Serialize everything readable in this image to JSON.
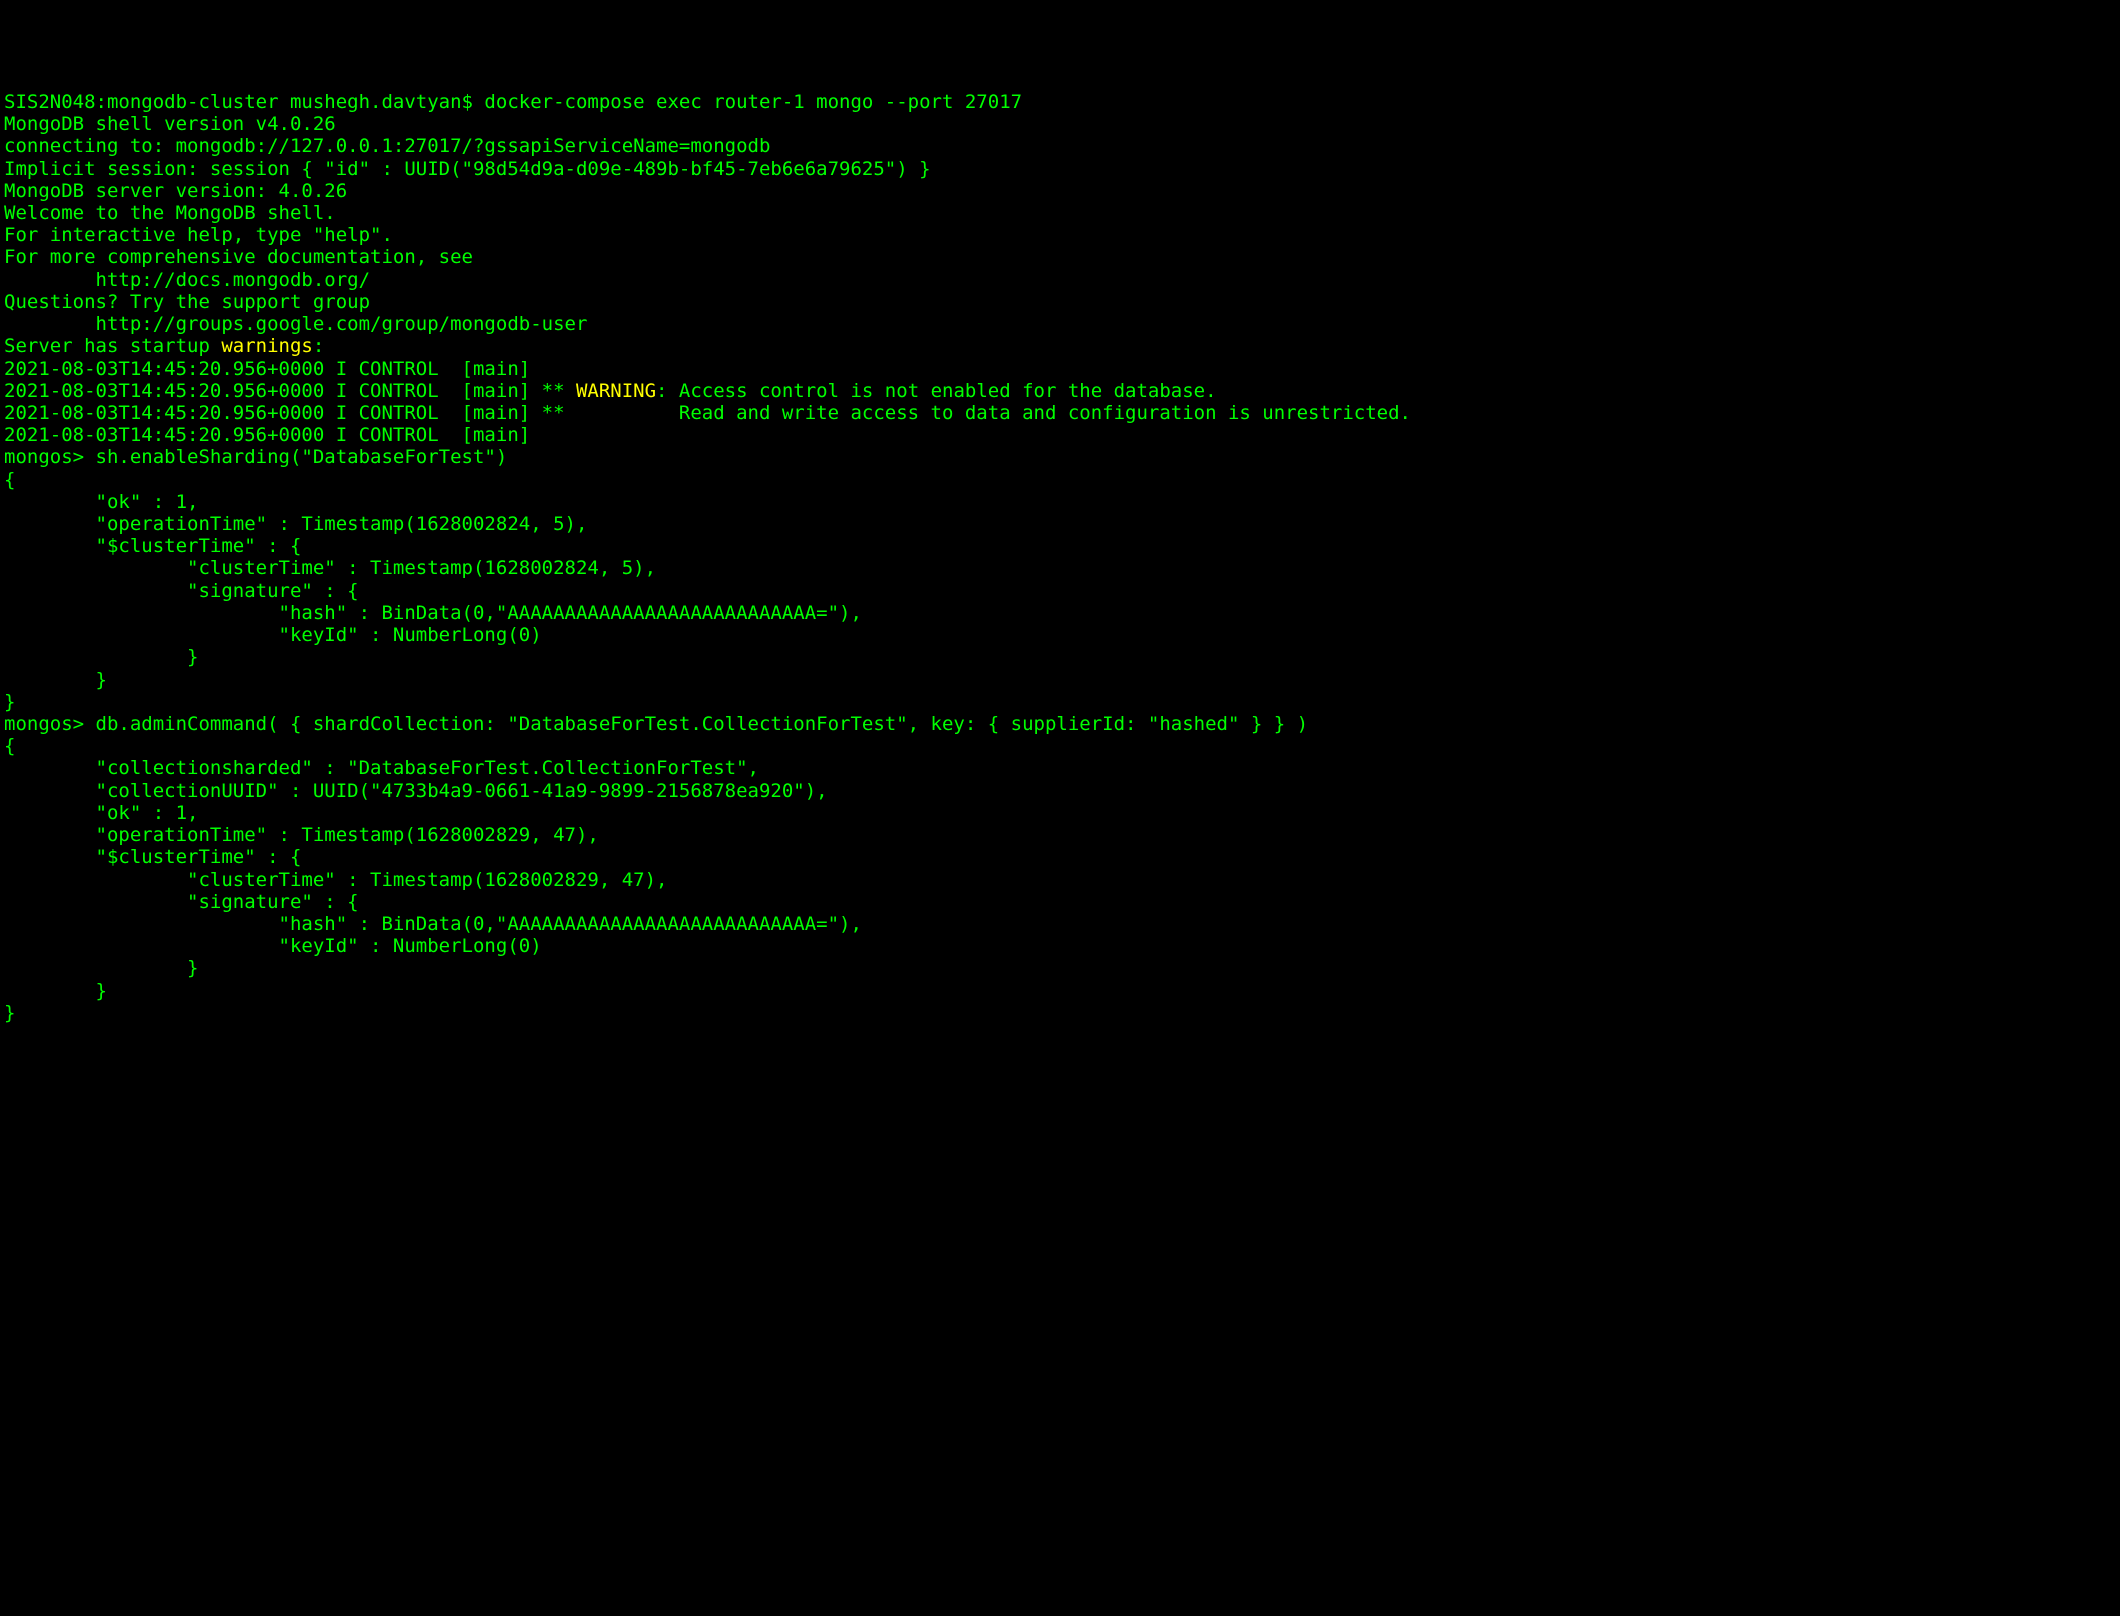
{
  "terminal": {
    "lines": [
      {
        "parts": [
          {
            "text": "SIS2N048:mongodb-cluster mushegh.davtyan$ docker-compose exec router-1 mongo --port 27017",
            "class": "green"
          }
        ]
      },
      {
        "parts": [
          {
            "text": "MongoDB shell version v4.0.26",
            "class": "green"
          }
        ]
      },
      {
        "parts": [
          {
            "text": "connecting to: mongodb://127.0.0.1:27017/?gssapiServiceName=mongodb",
            "class": "green"
          }
        ]
      },
      {
        "parts": [
          {
            "text": "Implicit session: session { \"id\" : UUID(\"98d54d9a-d09e-489b-bf45-7eb6e6a79625\") }",
            "class": "green"
          }
        ]
      },
      {
        "parts": [
          {
            "text": "MongoDB server version: 4.0.26",
            "class": "green"
          }
        ]
      },
      {
        "parts": [
          {
            "text": "Welcome to the MongoDB shell.",
            "class": "green"
          }
        ]
      },
      {
        "parts": [
          {
            "text": "For interactive help, type \"help\".",
            "class": "green"
          }
        ]
      },
      {
        "parts": [
          {
            "text": "For more comprehensive documentation, see",
            "class": "green"
          }
        ]
      },
      {
        "parts": [
          {
            "text": "        http://docs.mongodb.org/",
            "class": "green"
          }
        ]
      },
      {
        "parts": [
          {
            "text": "Questions? Try the support group",
            "class": "green"
          }
        ]
      },
      {
        "parts": [
          {
            "text": "        http://groups.google.com/group/mongodb-user",
            "class": "green"
          }
        ]
      },
      {
        "parts": [
          {
            "text": "Server has startup ",
            "class": "green"
          },
          {
            "text": "warnings",
            "class": "yellow"
          },
          {
            "text": ":",
            "class": "green"
          }
        ]
      },
      {
        "parts": [
          {
            "text": "2021-08-03T14:45:20.956+0000 I CONTROL  [main]",
            "class": "green"
          }
        ]
      },
      {
        "parts": [
          {
            "text": "2021-08-03T14:45:20.956+0000 I CONTROL  [main] ** ",
            "class": "green"
          },
          {
            "text": "WARNING",
            "class": "yellow"
          },
          {
            "text": ": Access control is not enabled for the database.",
            "class": "green"
          }
        ]
      },
      {
        "parts": [
          {
            "text": "2021-08-03T14:45:20.956+0000 I CONTROL  [main] **          Read and write access to data and configuration is unrestricted.",
            "class": "green"
          }
        ]
      },
      {
        "parts": [
          {
            "text": "2021-08-03T14:45:20.956+0000 I CONTROL  [main]",
            "class": "green"
          }
        ]
      },
      {
        "parts": [
          {
            "text": "mongos> sh.enableSharding(\"DatabaseForTest\")",
            "class": "green"
          }
        ]
      },
      {
        "parts": [
          {
            "text": "{",
            "class": "green"
          }
        ]
      },
      {
        "parts": [
          {
            "text": "        \"ok\" : 1,",
            "class": "green"
          }
        ]
      },
      {
        "parts": [
          {
            "text": "        \"operationTime\" : Timestamp(1628002824, 5),",
            "class": "green"
          }
        ]
      },
      {
        "parts": [
          {
            "text": "        \"$clusterTime\" : {",
            "class": "green"
          }
        ]
      },
      {
        "parts": [
          {
            "text": "                \"clusterTime\" : Timestamp(1628002824, 5),",
            "class": "green"
          }
        ]
      },
      {
        "parts": [
          {
            "text": "                \"signature\" : {",
            "class": "green"
          }
        ]
      },
      {
        "parts": [
          {
            "text": "                        \"hash\" : BinData(0,\"AAAAAAAAAAAAAAAAAAAAAAAAAAA=\"),",
            "class": "green"
          }
        ]
      },
      {
        "parts": [
          {
            "text": "                        \"keyId\" : NumberLong(0)",
            "class": "green"
          }
        ]
      },
      {
        "parts": [
          {
            "text": "                }",
            "class": "green"
          }
        ]
      },
      {
        "parts": [
          {
            "text": "        }",
            "class": "green"
          }
        ]
      },
      {
        "parts": [
          {
            "text": "}",
            "class": "green"
          }
        ]
      },
      {
        "parts": [
          {
            "text": "mongos> db.adminCommand( { shardCollection: \"DatabaseForTest.CollectionForTest\", key: { supplierId: \"hashed\" } } )",
            "class": "green"
          }
        ]
      },
      {
        "parts": [
          {
            "text": "{",
            "class": "green"
          }
        ]
      },
      {
        "parts": [
          {
            "text": "        \"collectionsharded\" : \"DatabaseForTest.CollectionForTest\",",
            "class": "green"
          }
        ]
      },
      {
        "parts": [
          {
            "text": "        \"collectionUUID\" : UUID(\"4733b4a9-0661-41a9-9899-2156878ea920\"),",
            "class": "green"
          }
        ]
      },
      {
        "parts": [
          {
            "text": "        \"ok\" : 1,",
            "class": "green"
          }
        ]
      },
      {
        "parts": [
          {
            "text": "        \"operationTime\" : Timestamp(1628002829, 47),",
            "class": "green"
          }
        ]
      },
      {
        "parts": [
          {
            "text": "        \"$clusterTime\" : {",
            "class": "green"
          }
        ]
      },
      {
        "parts": [
          {
            "text": "                \"clusterTime\" : Timestamp(1628002829, 47),",
            "class": "green"
          }
        ]
      },
      {
        "parts": [
          {
            "text": "                \"signature\" : {",
            "class": "green"
          }
        ]
      },
      {
        "parts": [
          {
            "text": "                        \"hash\" : BinData(0,\"AAAAAAAAAAAAAAAAAAAAAAAAAAA=\"),",
            "class": "green"
          }
        ]
      },
      {
        "parts": [
          {
            "text": "                        \"keyId\" : NumberLong(0)",
            "class": "green"
          }
        ]
      },
      {
        "parts": [
          {
            "text": "                }",
            "class": "green"
          }
        ]
      },
      {
        "parts": [
          {
            "text": "        }",
            "class": "green"
          }
        ]
      },
      {
        "parts": [
          {
            "text": "}",
            "class": "green"
          }
        ]
      }
    ]
  }
}
